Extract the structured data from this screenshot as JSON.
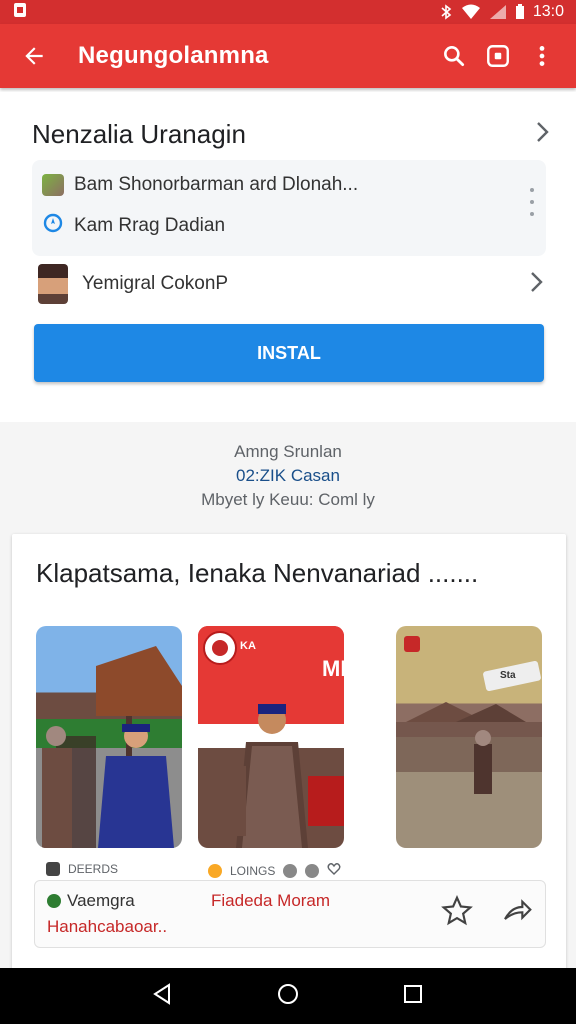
{
  "status_bar": {
    "time": "13:0"
  },
  "app_bar": {
    "title": "Negungolanmna"
  },
  "top_card": {
    "title": "Nenzalia Uranagin",
    "row1": "Bam Shonorbarman ard Dlonah...",
    "row2": "Kam Rrag Dadian",
    "person": "Yemigral CokonP",
    "install_label": "INSTAL"
  },
  "stats": {
    "line1": "Amng Srunlan",
    "line2": "02:ZIK Casan",
    "line3": "Mbyet ly Keuu: Coml ly"
  },
  "post": {
    "title": "Klapatsama, Ienaka Nenvanariad .......",
    "photo2_sign": "MERYA",
    "photo2_badge": "KA",
    "photo3_sign": "Sta",
    "meta1": "DEERDS",
    "meta2": "LOINGS",
    "footer": {
      "author": "Vaemgra",
      "subtitle": "Hanahcabaoar..",
      "mid": "Fiadeda Moram"
    }
  },
  "colors": {
    "app_bar": "#e53935",
    "status_bar": "#d32f2f",
    "install": "#1e88e5",
    "accent_text": "#c62828"
  }
}
